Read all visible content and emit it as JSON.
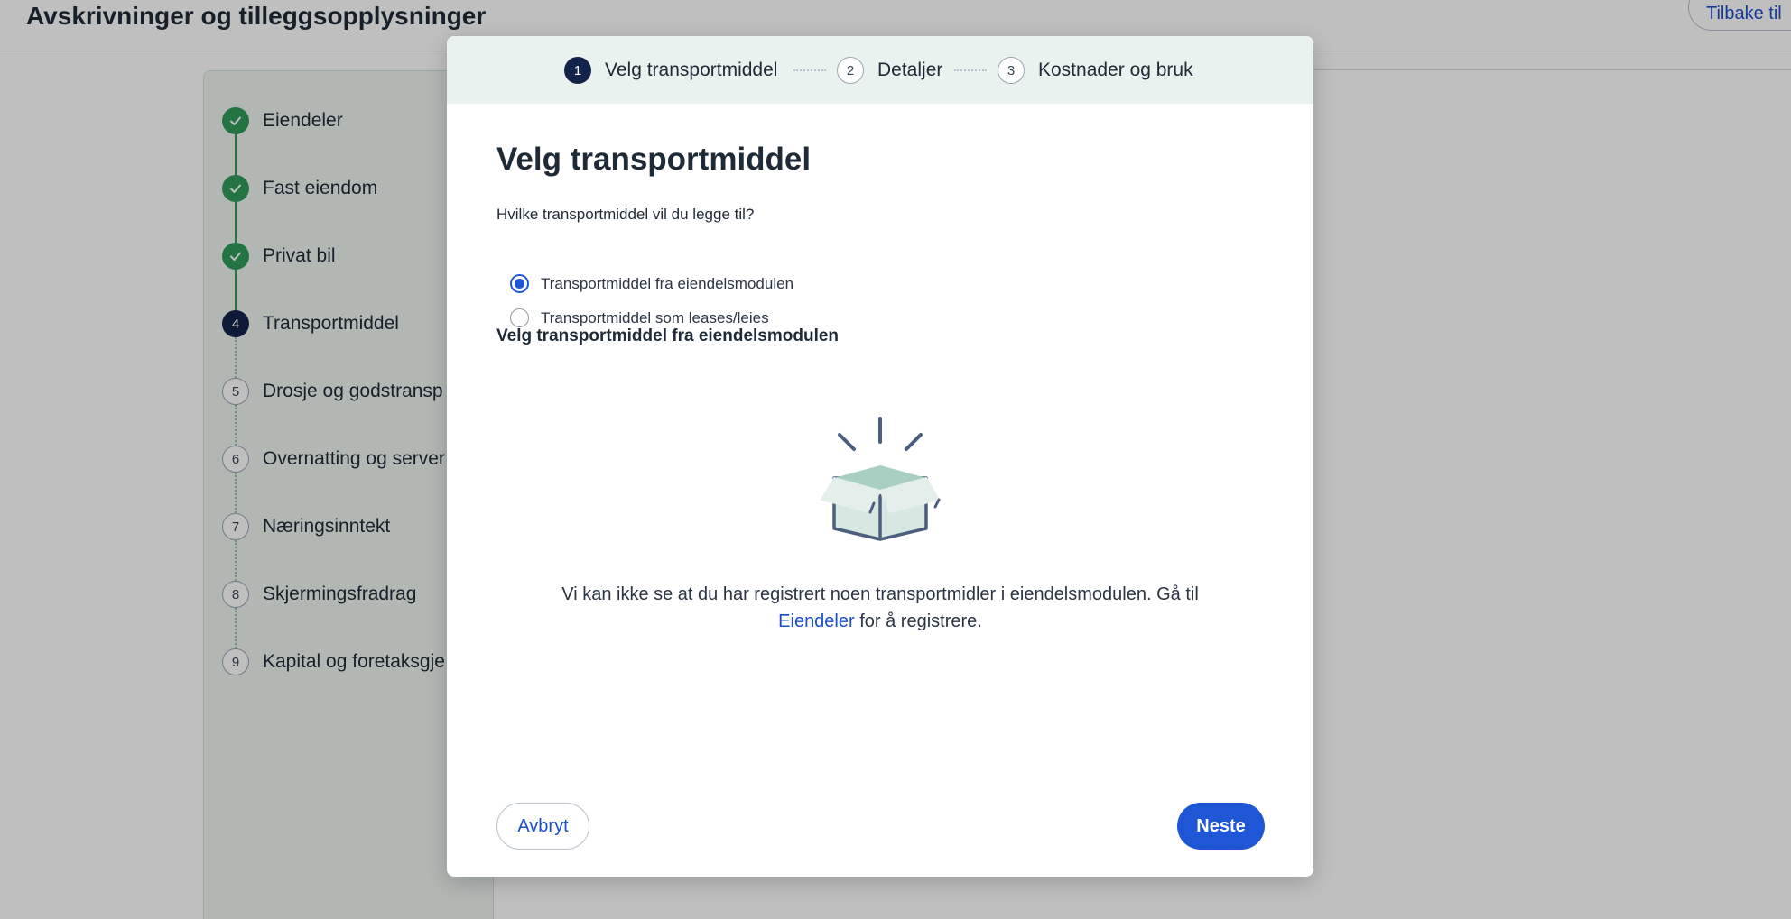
{
  "page": {
    "title": "Avskrivninger og tilleggsopplysninger",
    "back_button_label": "Tilbake til"
  },
  "stepper": {
    "steps": [
      {
        "number": "",
        "label": "Eiendeler",
        "status": "done"
      },
      {
        "number": "",
        "label": "Fast eiendom",
        "status": "done"
      },
      {
        "number": "",
        "label": "Privat bil",
        "status": "done"
      },
      {
        "number": "4",
        "label": "Transportmiddel",
        "status": "active"
      },
      {
        "number": "5",
        "label": "Drosje og godstransp",
        "status": "pending"
      },
      {
        "number": "6",
        "label": "Overnatting og server",
        "status": "pending"
      },
      {
        "number": "7",
        "label": "Næringsinntekt",
        "status": "pending"
      },
      {
        "number": "8",
        "label": "Skjermingsfradrag",
        "status": "pending"
      },
      {
        "number": "9",
        "label": "Kapital og foretaksgje",
        "status": "pending"
      }
    ]
  },
  "modal": {
    "steps": [
      {
        "number": "1",
        "label": "Velg transportmiddel",
        "status": "active"
      },
      {
        "number": "2",
        "label": "Detaljer",
        "status": "pending"
      },
      {
        "number": "3",
        "label": "Kostnader og bruk",
        "status": "pending"
      }
    ],
    "heading": "Velg transportmiddel",
    "question": "Hvilke transportmiddel vil du legge til?",
    "options": [
      {
        "label": "Transportmiddel fra eiendelsmodulen",
        "checked": true
      },
      {
        "label": "Transportmiddel som leases/leies",
        "checked": false
      }
    ],
    "subheading": "Velg transportmiddel fra eiendelsmodulen",
    "empty_state": {
      "text_before": "Vi kan ikke se at du har registrert noen transportmidler i eiendelsmodulen. Gå til",
      "link_text": "Eiendeler",
      "text_after": "for å registrere."
    },
    "cancel_label": "Avbryt",
    "next_label": "Neste"
  },
  "colors": {
    "accent": "#1f56d6",
    "done": "#2f9a5a",
    "active_step": "#13234a",
    "stepper_bg": "#e9f2ef"
  }
}
